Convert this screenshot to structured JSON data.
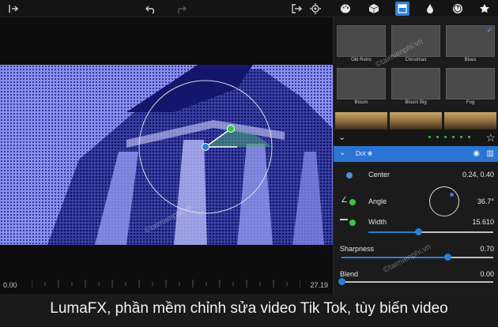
{
  "toolbar": {
    "icons": [
      "exit-icon",
      "undo-icon",
      "redo-icon",
      "export-icon",
      "settings-icon",
      "palette-icon",
      "cube-icon",
      "layers-icon",
      "drop-icon",
      "swirl-icon",
      "star-icon"
    ]
  },
  "video": {
    "time_start": "0.00",
    "time_end": "27.19"
  },
  "presets": [
    {
      "label": "Old Retro",
      "selected": false
    },
    {
      "label": "Christmas",
      "selected": false
    },
    {
      "label": "Blues",
      "selected": true
    },
    {
      "label": "Bloom",
      "selected": false
    },
    {
      "label": "Bloom Big",
      "selected": false
    },
    {
      "label": "Fog",
      "selected": false
    }
  ],
  "layer": {
    "name": "Dot ❀"
  },
  "params": {
    "center": {
      "label": "Center",
      "value": "0.24, 0.40"
    },
    "angle": {
      "label": "Angle",
      "value": "36.7°",
      "degrees": 36.7
    },
    "width": {
      "label": "Width",
      "value": "15.610",
      "fraction": 0.4
    },
    "sharpness": {
      "label": "Sharpness",
      "value": "0.70",
      "fraction": 0.7
    },
    "blend": {
      "label": "Blend",
      "value": "0.00",
      "fraction": 0.0
    }
  },
  "caption": "LumaFX, phần mềm chỉnh sửa video Tik Tok, tùy biến video",
  "watermark": "©taimienphi.vn",
  "colors": {
    "accent": "#2b7fd8",
    "green": "#36c940",
    "tint": "#7f86f0"
  }
}
